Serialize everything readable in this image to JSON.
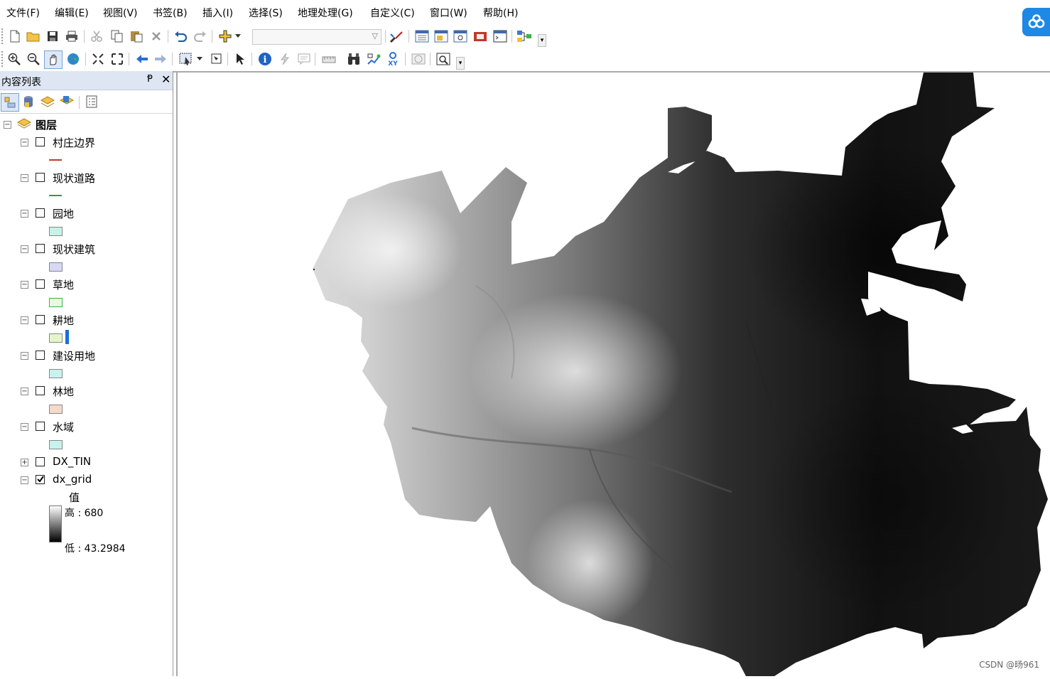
{
  "menu": [
    "文件(F)",
    "编辑(E)",
    "视图(V)",
    "书签(B)",
    "插入(I)",
    "选择(S)",
    "地理处理(G)",
    "自定义(C)",
    "窗口(W)",
    "帮助(H)"
  ],
  "toc": {
    "title": "内容列表",
    "pin": "Ᵽ",
    "close": "✕",
    "root": "图层",
    "layers": [
      {
        "name": "村庄边界",
        "checked": false,
        "symbol": "line",
        "color": "#c0392b"
      },
      {
        "name": "现状道路",
        "checked": false,
        "symbol": "line",
        "color": "#2e9e3c"
      },
      {
        "name": "园地",
        "checked": false,
        "symbol": "box",
        "color": "#c8f2e6"
      },
      {
        "name": "现状建筑",
        "checked": false,
        "symbol": "box",
        "color": "#d6d8f5"
      },
      {
        "name": "草地",
        "checked": false,
        "symbol": "box",
        "color": "#eaf7e1"
      },
      {
        "name": "耕地",
        "checked": false,
        "symbol": "box",
        "color": "#e5f5c9"
      },
      {
        "name": "建设用地",
        "checked": false,
        "symbol": "box",
        "color": "#c8f2ee"
      },
      {
        "name": "林地",
        "checked": false,
        "symbol": "box",
        "color": "#f7d9c9"
      },
      {
        "name": "水域",
        "checked": false,
        "symbol": "box",
        "color": "#c8f2ee"
      },
      {
        "name": "DX_TIN",
        "checked": false,
        "symbol": "none",
        "color": ""
      },
      {
        "name": "dx_grid",
        "checked": true,
        "symbol": "none",
        "color": ""
      }
    ],
    "legend": {
      "heading": "值",
      "high": "高 : 680",
      "low": "低 : 43.2984"
    }
  },
  "watermark": "CSDN @旸961"
}
